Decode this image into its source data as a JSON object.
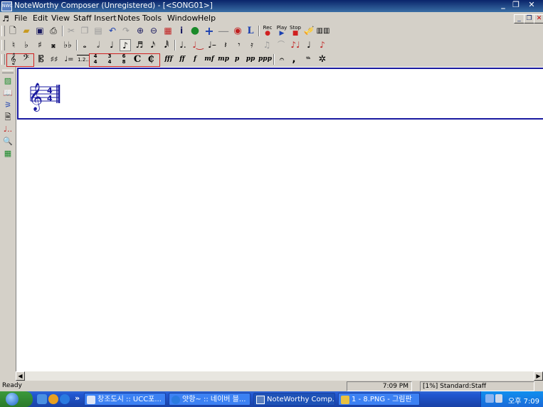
{
  "window": {
    "title": "NoteWorthy Composer (Unregistered) - [<SONG01>]",
    "app_icon": "NWC",
    "minimize": "_",
    "restore": "❐",
    "close": "✕",
    "mdi_minimize": "_",
    "mdi_restore": "❐",
    "mdi_close": "✕"
  },
  "menu": {
    "items": [
      "File",
      "Edit",
      "View",
      "Staff",
      "Insert",
      "Notes",
      "Tools",
      "Window",
      "Help"
    ]
  },
  "toolbar1": {
    "play_labels": {
      "rec": "Rec",
      "play": "Play",
      "stop": "Stop"
    },
    "icons": [
      "new-icon",
      "open-icon",
      "save-icon",
      "print-icon",
      "cut-icon",
      "copy-icon",
      "paste-icon",
      "undo-icon",
      "redo-icon",
      "zoom-in-icon",
      "zoom-out-icon",
      "pages-icon",
      "info-icon",
      "globe-icon",
      "add-staff-icon",
      "remove-staff-icon",
      "volume-icon",
      "lyric-icon",
      "record-icon",
      "play-icon",
      "stop-icon",
      "instrument-icon",
      "keyboard-icon"
    ],
    "glyphs": {
      "lyric": "L",
      "info": "i"
    }
  },
  "toolbar2": {
    "icons": [
      "natural-icon",
      "flat-icon",
      "sharp-icon",
      "double-sharp-icon",
      "double-flat-icon",
      "whole-note-icon",
      "half-note-icon",
      "quarter-note-icon",
      "eighth-note-icon",
      "sixteenth-note-icon",
      "thirty-second-note-icon",
      "sixty-fourth-note-icon",
      "dotted-note-icon",
      "tie-icon",
      "triplet-icon",
      "rest-icon",
      "rest2-icon",
      "rest3-icon",
      "beam-icon",
      "slur-icon",
      "grace-icon",
      "stem-icon",
      "tenuto-icon"
    ]
  },
  "toolbar3": {
    "icons": [
      "treble-clef-icon",
      "bass-clef-icon",
      "alto-clef-icon",
      "key-signature-icon",
      "tempo-icon",
      "ending-icon",
      "time-4-4-icon",
      "time-3-4-icon",
      "time-6-8-icon",
      "common-time-icon",
      "cut-time-icon",
      "fermata-icon",
      "breath-mark-icon",
      "pedal-icon",
      "pedal-release-icon"
    ],
    "dynamics": [
      "fff",
      "ff",
      "f",
      "mf",
      "mp",
      "p",
      "pp",
      "ppp"
    ],
    "time_sigs": [
      {
        "top": "4",
        "bottom": "4"
      },
      {
        "top": "3",
        "bottom": "4"
      },
      {
        "top": "6",
        "bottom": "8"
      }
    ],
    "ending_label": "1.2..",
    "common_time": "C",
    "cut_time": "₵"
  },
  "sidebar": {
    "icons": [
      "staff-properties-icon",
      "book-icon",
      "instrument-audio-icon",
      "print-preview-icon",
      "note-entry-icon",
      "zoom-icon",
      "grid-view-icon"
    ]
  },
  "staff": {
    "clef": "treble",
    "time_signature": {
      "top": "4",
      "bottom": "4"
    }
  },
  "statusbar": {
    "ready": "Ready",
    "time": "7:09 PM",
    "staff_info": "[1%] Standard:Staff"
  },
  "taskbar": {
    "tasks": [
      {
        "label": "창조도시 :: UCC포...",
        "active": false
      },
      {
        "label": "얏항~ :: 네이버 블...",
        "active": false
      },
      {
        "label": "NoteWorthy Comp...",
        "active": true
      },
      {
        "label": "1 - 8.PNG - 그림판",
        "active": false
      }
    ],
    "chevron": "»",
    "clock": "오후 7:09"
  }
}
